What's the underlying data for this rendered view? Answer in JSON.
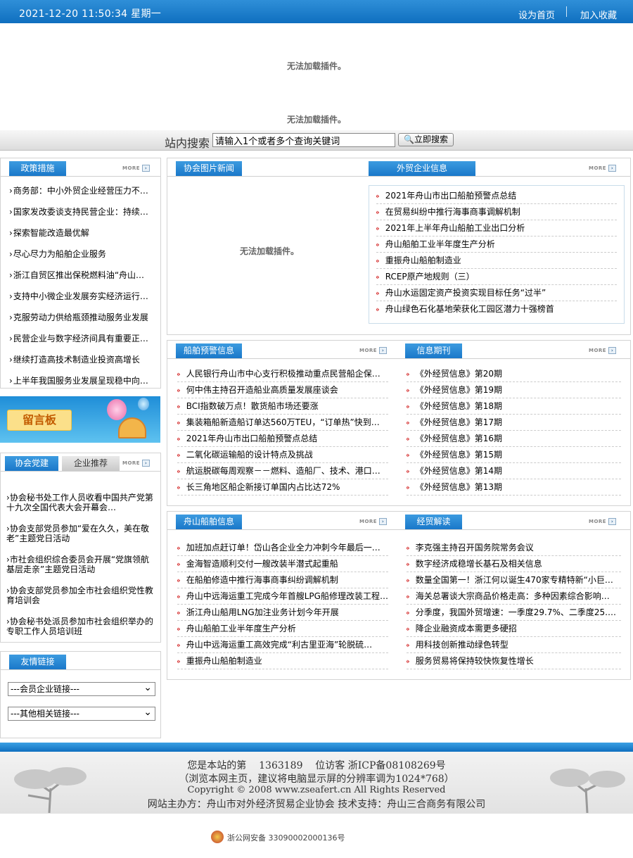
{
  "topbar": {
    "datetime": "2021-12-20 11:50:34 星期一",
    "set_home": "设为首页",
    "bookmark": "加入收藏"
  },
  "plugin": {
    "msg1": "无法加载插件。",
    "msg2": "无法加载插件。",
    "msg3": "无法加载插件。"
  },
  "search": {
    "label": "站内搜索",
    "value": "请输入1个或者多个查询关键词",
    "button": "立即搜索"
  },
  "more_label": "MORE",
  "policy": {
    "title": "政策措施",
    "items": [
      "商务部：中小外贸企业经营压力不断加大",
      "国家发改委谈支持民营企业：持续推进",
      "探索智能改造最优解",
      "尽心尽力为船舶企业服务",
      "浙江自贸区推出保税燃料油“舟山价格”",
      "支持中小微企业发展夯实经济运行基础",
      "克服劳动力供给瓶颈推动服务业发展",
      "民营企业与数字经济间具有重要正向关系",
      "继续打造高技术制造业投资高增长",
      "上半年我国服务业发展呈现稳中向好态势"
    ]
  },
  "message_board": {
    "label": "留言板"
  },
  "party": {
    "tab1": "协会党建",
    "tab2": "企业推荐",
    "items": [
      "协会秘书处工作人员收看中国共产党第十九次全国代表大会开幕会…",
      "协会支部党员参加“爱在久久，美在敬老”主题党日活动",
      "市社会组织综合委员会开展“党旗领航基层走亲”主题党日活动",
      "协会支部党员参加全市社会组织党性教育培训会",
      "协会秘书处派员参加市社会组织举办的专职工作人员培训班"
    ]
  },
  "links": {
    "title": "友情链接",
    "select1": "---会员企业链接---",
    "select2": "---其他相关链接---"
  },
  "photo_news": {
    "title": "协会图片新闻"
  },
  "foreign": {
    "title": "外贸企业信息",
    "items": [
      "2021年舟山市出口船舶预警点总结",
      "在贸易纠纷中推行海事商事调解机制",
      "2021年上半年舟山船舶工业出口分析",
      "舟山船舶工业半年度生产分析",
      "重振舟山船舶制造业",
      "RCEP原产地规则（三）",
      "舟山水运固定资产投资实现目标任务“过半”",
      "舟山绿色石化基地荣获化工园区潜力十强榜首"
    ]
  },
  "ship_warning": {
    "title": "船舶预警信息",
    "items": [
      "人民银行舟山市中心支行积极推动重点民营船企保…",
      "何中伟主持召开造船业高质量发展座谈会",
      "BCI指数破万点！散货船市场还要涨",
      "集装箱船新造船订单达560万TEU，“订单热”快到…",
      "2021年舟山市出口船舶预警点总结",
      "二氧化碳运输船的设计特点及挑战",
      "航运脱碳每周观察－－燃料、造船厂、技术、港口…",
      "长三角地区船企新接订单国内占比达72%"
    ]
  },
  "periodical": {
    "title": "信息期刊",
    "items": [
      "《外经贸信息》第20期",
      "《外经贸信息》第19期",
      "《外经贸信息》第18期",
      "《外经贸信息》第17期",
      "《外经贸信息》第16期",
      "《外经贸信息》第15期",
      "《外经贸信息》第14期",
      "《外经贸信息》第13期"
    ]
  },
  "zs_ship": {
    "title": "舟山船舶信息",
    "items": [
      "加班加点赶订单！岱山各企业全力冲刺今年最后一…",
      "金海智造顺利交付一艘改装半潜式起重船",
      "在船舶修造中推行海事商事纠纷调解机制",
      "舟山中远海运重工完成今年首艘LPG船修理改装工程…",
      "浙江舟山船用LNG加注业务计划今年开展",
      "舟山船舶工业半年度生产分析",
      "舟山中远海运重工高效完成“利古里亚海”轮脱硫…",
      "重振舟山船舶制造业"
    ]
  },
  "economy": {
    "title": "经贸解读",
    "items": [
      "李克强主持召开国务院常务会议",
      "数字经济成稳增长基石及相关信息",
      "数量全国第一！浙江何以诞生470家专精特新“小巨…",
      "海关总署谈大宗商品价格走高：多种因素综合影响…",
      "分季度，我国外贸增速：一季度29.7%、二季度25.…",
      "降企业融资成本需更多硬招",
      "用科技创新推动绿色转型",
      "服务贸易将保持较快恢复性增长"
    ]
  },
  "footer": {
    "visitor_prefix": "您是本站的第",
    "visitor_count": "1363189",
    "visitor_suffix": "位访客",
    "icp": "浙ICP备08108269号",
    "resolution": "（浏览本网主页，建议将电脑显示屏的分辨率调为1024*768）",
    "copyright": "Copyright © 2008 www.zseafert.cn All Rights Reserved",
    "host": "网站主办方：舟山市对外经济贸易企业协会 技术支持：舟山三合商务有限公司",
    "police": "浙公网安备 33090002000136号"
  }
}
